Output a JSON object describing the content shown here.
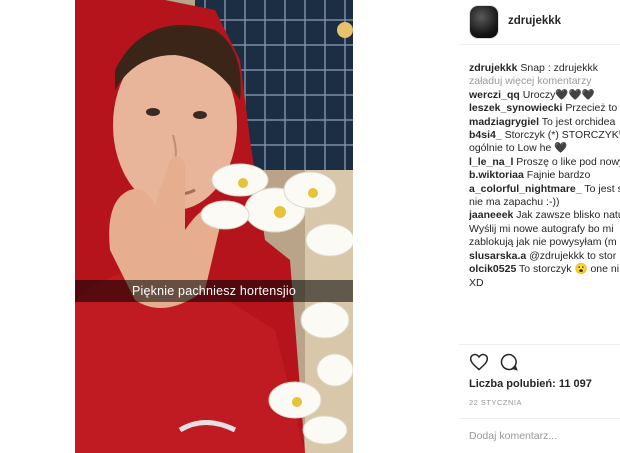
{
  "post": {
    "snap_caption": "Pięknie pachniesz hortensjio"
  },
  "header": {
    "username": "zdrujekkk"
  },
  "comments": {
    "caption_user": "zdrujekkk",
    "caption_text": "Snap : zdrujekkk",
    "load_more": "załaduj więcej komentarzy",
    "items": [
      {
        "lines": [
          {
            "user": "werczi_qq",
            "text": "Uroczy🖤🖤🖤"
          }
        ]
      },
      {
        "lines": [
          {
            "user": "leszek_synowiecki",
            "text": "Przecież to s"
          }
        ]
      },
      {
        "lines": [
          {
            "user": "madziagrygiel",
            "text": "To jest orchidea"
          }
        ]
      },
      {
        "lines": [
          {
            "user": "b4si4_",
            "text": "Storczyk (*) STORCZYK🖤"
          },
          {
            "user": "",
            "text": "ogólnie to Low he 🖤"
          }
        ]
      },
      {
        "lines": [
          {
            "user": "l_le_na_l",
            "text": "Proszę o like pod nowy"
          }
        ]
      },
      {
        "lines": [
          {
            "user": "b.wiktoriaa",
            "text": "Fajnie bardzo"
          }
        ]
      },
      {
        "lines": [
          {
            "user": "a_colorful_nightmare_",
            "text": "To jest s"
          },
          {
            "user": "",
            "text": "nie ma zapachu :-))"
          }
        ]
      },
      {
        "lines": [
          {
            "user": "jaaneeek",
            "text": "Jak zawsze blisko natu"
          },
          {
            "user": "",
            "text": "Wyślij mi nowe autografy bo mi"
          },
          {
            "user": "",
            "text": "zablokują jak nie powysyłam (m"
          }
        ]
      },
      {
        "lines": [
          {
            "user": "slusarska.a",
            "text": "@zdrujekkk to stor"
          }
        ]
      },
      {
        "lines": [
          {
            "user": "olcik0525",
            "text": "To storczyk 😮 one ni"
          },
          {
            "user": "",
            "text": "XD"
          }
        ]
      }
    ]
  },
  "likes": {
    "text": "Liczba polubień: 11 097"
  },
  "date": {
    "text": "22 STYCZNIA"
  },
  "add_comment": {
    "placeholder": "Dodaj komentarz..."
  },
  "icons": {
    "like": "heart-icon",
    "comment": "comment-icon"
  }
}
